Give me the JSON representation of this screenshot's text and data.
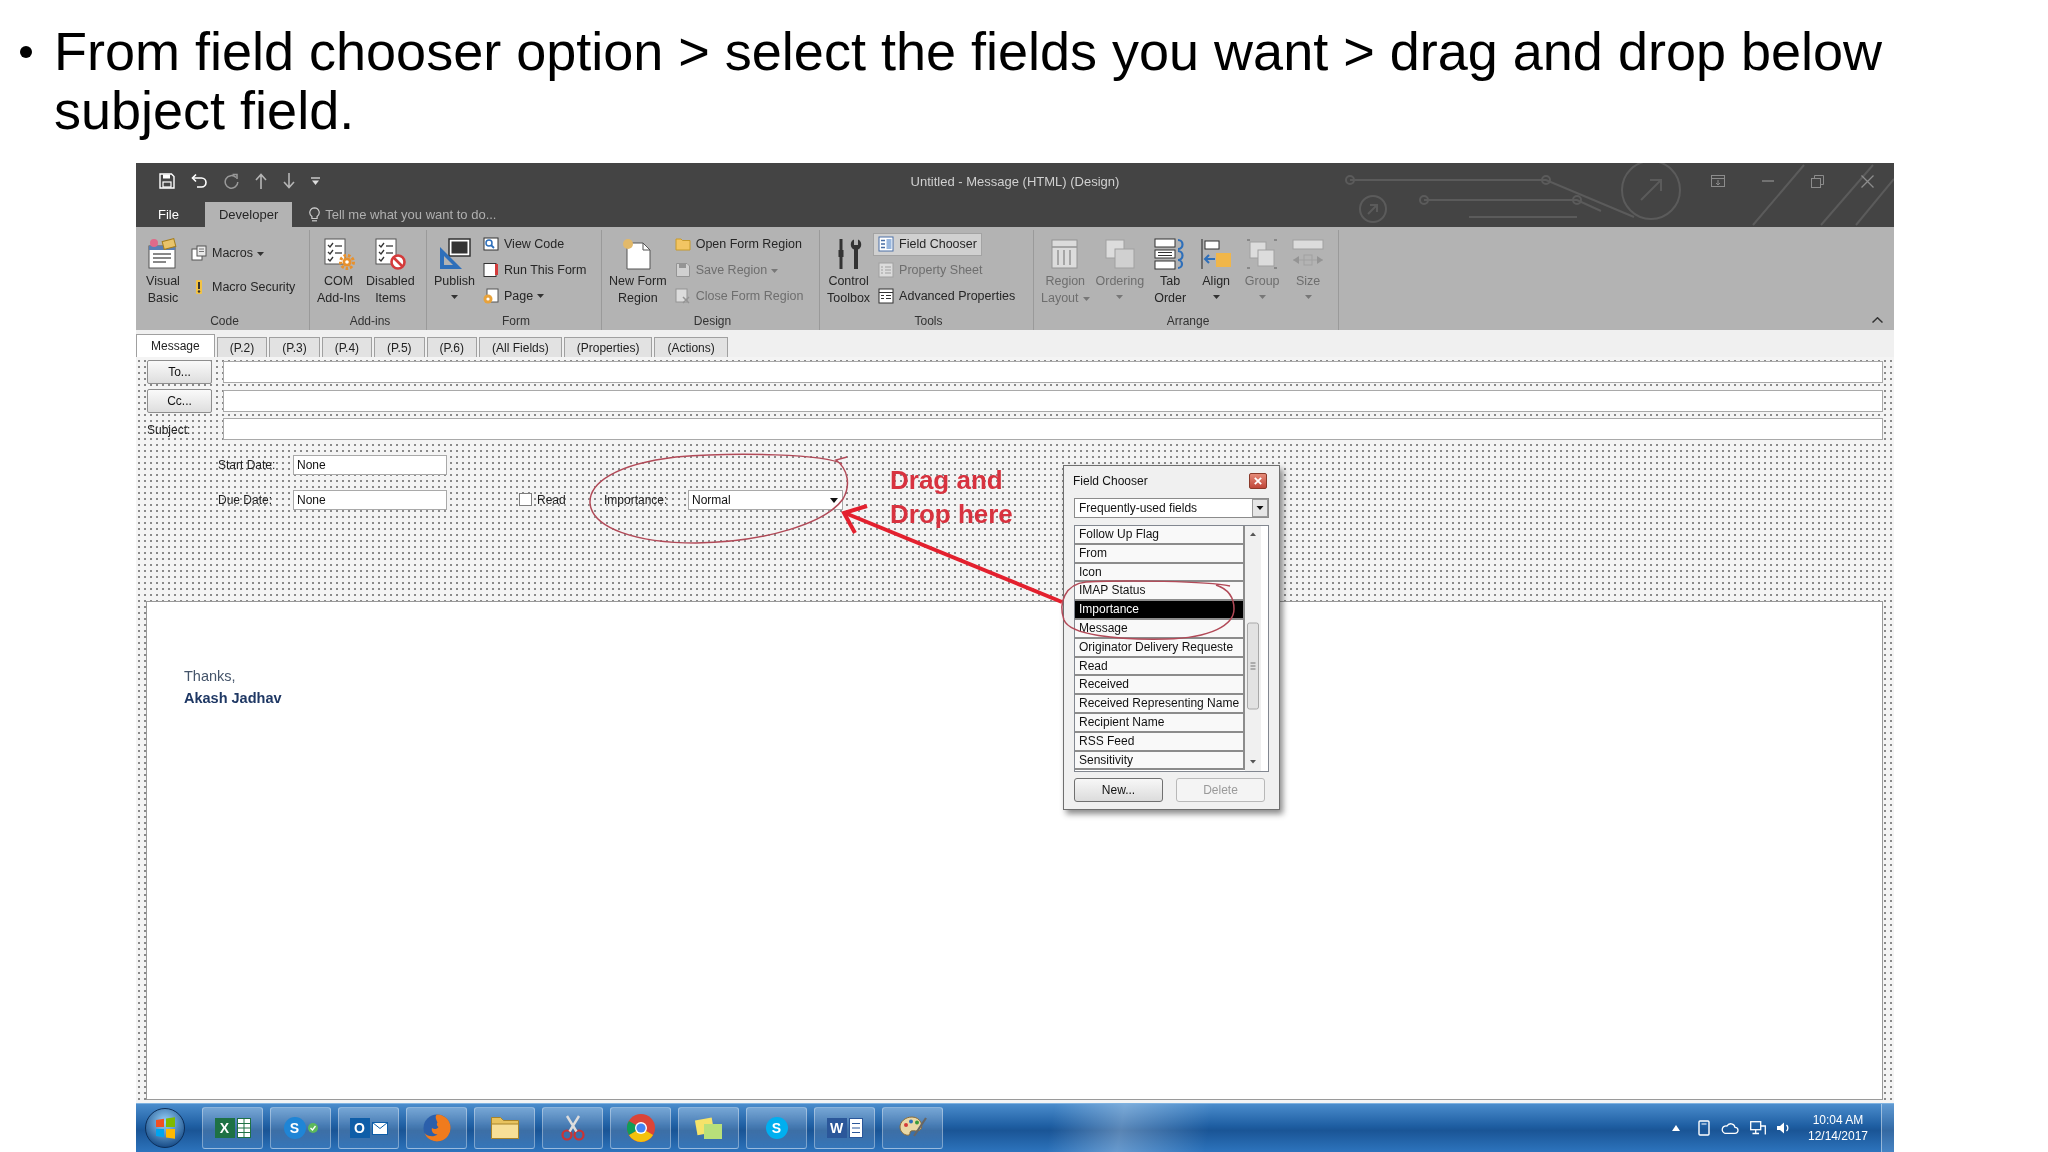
{
  "slide": {
    "bullet": "From field chooser option > select the fields you want > drag and drop below subject field."
  },
  "window": {
    "title": "Untitled - Message (HTML) (Design)"
  },
  "ribbon_tabs": [
    {
      "label": "File",
      "selected": false
    },
    {
      "label": "Developer",
      "selected": true
    }
  ],
  "tell_me": {
    "placeholder": "Tell me what you want to do..."
  },
  "ribbon_groups": [
    {
      "label": "Code",
      "items": [
        {
          "kind": "large",
          "label": "Visual\nBasic",
          "dropdown": false,
          "disabled": false,
          "on": false
        },
        {
          "kind": "small",
          "label": "Macros",
          "dropdown": true,
          "disabled": false,
          "on": false
        },
        {
          "kind": "small",
          "label": "Macro Security",
          "dropdown": false,
          "disabled": false,
          "on": false
        }
      ]
    },
    {
      "label": "Add-ins",
      "items": [
        {
          "kind": "large",
          "label": "COM\nAdd-Ins",
          "dropdown": false,
          "disabled": false,
          "on": false
        },
        {
          "kind": "large",
          "label": "Disabled\nItems",
          "dropdown": false,
          "disabled": false,
          "on": false
        }
      ]
    },
    {
      "label": "Form",
      "items": [
        {
          "kind": "large",
          "label": "Publish",
          "dropdown": true,
          "disabled": false,
          "on": false
        },
        {
          "kind": "small",
          "label": "View Code",
          "dropdown": false,
          "disabled": false,
          "on": false
        },
        {
          "kind": "small",
          "label": "Run This Form",
          "dropdown": false,
          "disabled": false,
          "on": false
        },
        {
          "kind": "small",
          "label": "Page",
          "dropdown": true,
          "disabled": false,
          "on": false
        }
      ]
    },
    {
      "label": "Design",
      "items": [
        {
          "kind": "large",
          "label": "New Form\nRegion",
          "dropdown": false,
          "disabled": false,
          "on": false
        },
        {
          "kind": "small",
          "label": "Open Form Region",
          "dropdown": false,
          "disabled": false,
          "on": false
        },
        {
          "kind": "small",
          "label": "Save Region",
          "dropdown": true,
          "disabled": true,
          "on": false
        },
        {
          "kind": "small",
          "label": "Close Form Region",
          "dropdown": false,
          "disabled": true,
          "on": false
        }
      ]
    },
    {
      "label": "Tools",
      "items": [
        {
          "kind": "large",
          "label": "Control\nToolbox",
          "dropdown": false,
          "disabled": false,
          "on": false
        },
        {
          "kind": "small",
          "label": "Field Chooser",
          "dropdown": false,
          "disabled": false,
          "on": true
        },
        {
          "kind": "small",
          "label": "Property Sheet",
          "dropdown": false,
          "disabled": true,
          "on": false
        },
        {
          "kind": "small",
          "label": "Advanced Properties",
          "dropdown": false,
          "disabled": false,
          "on": false
        }
      ]
    },
    {
      "label": "Arrange",
      "items": [
        {
          "kind": "large",
          "label": "Region\nLayout",
          "dropdown": true,
          "disabled": true,
          "on": false
        },
        {
          "kind": "large",
          "label": "Ordering",
          "dropdown": true,
          "disabled": true,
          "on": false
        },
        {
          "kind": "large",
          "label": "Tab\nOrder",
          "dropdown": false,
          "disabled": false,
          "on": false
        },
        {
          "kind": "large",
          "label": "Align",
          "dropdown": true,
          "disabled": false,
          "on": false
        },
        {
          "kind": "large",
          "label": "Group",
          "dropdown": true,
          "disabled": true,
          "on": false
        },
        {
          "kind": "large",
          "label": "Size",
          "dropdown": true,
          "disabled": true,
          "on": false
        }
      ]
    }
  ],
  "form_tabs": [
    {
      "label": "Message",
      "selected": true
    },
    {
      "label": "(P.2)",
      "selected": false
    },
    {
      "label": "(P.3)",
      "selected": false
    },
    {
      "label": "(P.4)",
      "selected": false
    },
    {
      "label": "(P.5)",
      "selected": false
    },
    {
      "label": "(P.6)",
      "selected": false
    },
    {
      "label": "(All Fields)",
      "selected": false
    },
    {
      "label": "(Properties)",
      "selected": false
    },
    {
      "label": "(Actions)",
      "selected": false
    }
  ],
  "form": {
    "address_rows": [
      {
        "kind": "button",
        "label": "To..."
      },
      {
        "kind": "button",
        "label": "Cc..."
      },
      {
        "kind": "label",
        "label": "Subject:"
      }
    ],
    "start_date": {
      "label": "Start Date:",
      "value": "None"
    },
    "due_date": {
      "label": "Due Date:",
      "value": "None"
    },
    "read": {
      "label": "Read",
      "checked": false
    },
    "importance": {
      "label": "Importance:",
      "value": "Normal"
    }
  },
  "annotation": {
    "text": "Drag and\nDrop here"
  },
  "message_body": {
    "lines": [
      {
        "kind": "closing",
        "text": "Thanks,"
      },
      {
        "kind": "signature",
        "text": "Akash Jadhav"
      }
    ]
  },
  "field_chooser": {
    "title": "Field Chooser",
    "category": "Frequently-used fields",
    "fields": [
      {
        "label": "Follow Up Flag",
        "selected": false
      },
      {
        "label": "From",
        "selected": false
      },
      {
        "label": "Icon",
        "selected": false
      },
      {
        "label": "IMAP Status",
        "selected": false
      },
      {
        "label": "Importance",
        "selected": true
      },
      {
        "label": "Message",
        "selected": false
      },
      {
        "label": "Originator Delivery Requeste",
        "selected": false
      },
      {
        "label": "Read",
        "selected": false
      },
      {
        "label": "Received",
        "selected": false
      },
      {
        "label": "Received Representing Name",
        "selected": false
      },
      {
        "label": "Recipient Name",
        "selected": false
      },
      {
        "label": "RSS Feed",
        "selected": false
      },
      {
        "label": "Sensitivity",
        "selected": false
      }
    ],
    "buttons": [
      {
        "label": "New...",
        "disabled": false
      },
      {
        "label": "Delete",
        "disabled": true
      }
    ]
  },
  "taskbar": {
    "apps": [
      {
        "kind": "start"
      },
      {
        "kind": "spreadsheet",
        "glyph": "X"
      },
      {
        "kind": "messenger",
        "glyph": "S"
      },
      {
        "kind": "mail",
        "glyph": "O"
      },
      {
        "kind": "browser"
      },
      {
        "kind": "folder"
      },
      {
        "kind": "scissors"
      },
      {
        "kind": "wheel"
      },
      {
        "kind": "notes"
      },
      {
        "kind": "chat",
        "glyph": "S"
      },
      {
        "kind": "document",
        "glyph": "W"
      },
      {
        "kind": "palette"
      }
    ],
    "clock": {
      "time": "10:04 AM",
      "date": "12/14/2017"
    }
  }
}
